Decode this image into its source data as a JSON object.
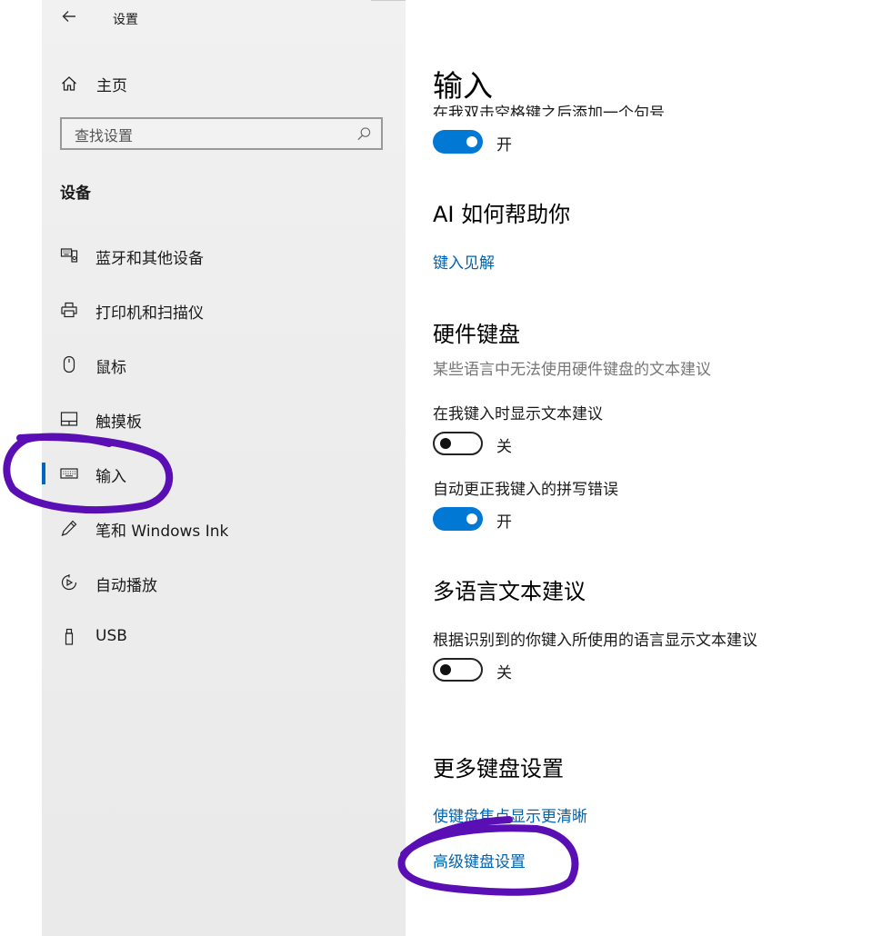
{
  "window": {
    "title": "设置"
  },
  "sidebar": {
    "home_label": "主页",
    "search_placeholder": "查找设置",
    "section_title": "设备",
    "items": [
      {
        "label": "蓝牙和其他设备",
        "icon": "bluetooth-devices-icon"
      },
      {
        "label": "打印机和扫描仪",
        "icon": "printer-icon"
      },
      {
        "label": "鼠标",
        "icon": "mouse-icon"
      },
      {
        "label": "触摸板",
        "icon": "touchpad-icon"
      },
      {
        "label": "输入",
        "icon": "keyboard-icon",
        "selected": true
      },
      {
        "label": "笔和 Windows Ink",
        "icon": "pen-icon"
      },
      {
        "label": "自动播放",
        "icon": "autoplay-icon"
      },
      {
        "label": "USB",
        "icon": "usb-icon"
      }
    ]
  },
  "main": {
    "title": "输入",
    "cut_text": "在我双击空格键之后添加一个句号",
    "cut_toggle": {
      "state": "开",
      "on": true
    },
    "ai": {
      "heading": "AI 如何帮助你",
      "link": "键入见解"
    },
    "hardware": {
      "heading": "硬件键盘",
      "desc": "某些语言中无法使用硬件键盘的文本建议",
      "setting1": {
        "label": "在我键入时显示文本建议",
        "state": "关",
        "on": false
      },
      "setting2": {
        "label": "自动更正我键入的拼写错误",
        "state": "开",
        "on": true
      }
    },
    "multilang": {
      "heading": "多语言文本建议",
      "setting": {
        "label": "根据识别到的你键入所使用的语言显示文本建议",
        "state": "关",
        "on": false
      }
    },
    "more": {
      "heading": "更多键盘设置",
      "link1": "使键盘焦点显示更清晰",
      "link2": "高级键盘设置"
    }
  },
  "colors": {
    "accent": "#0078d4",
    "link": "#0063b1",
    "annotation": "#5a0fb5"
  }
}
